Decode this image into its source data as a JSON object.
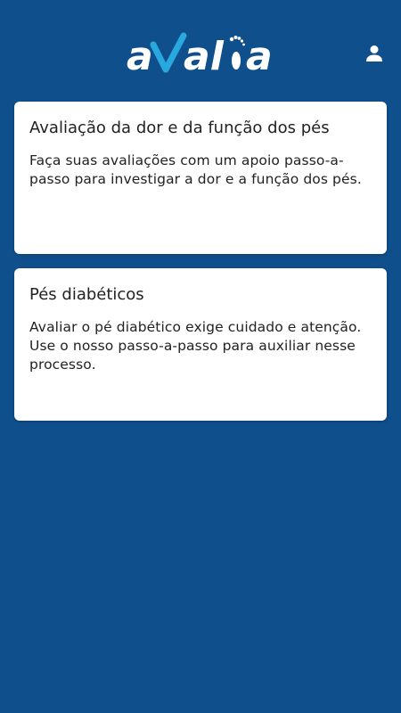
{
  "app": {
    "name": "avalia",
    "colors": {
      "background": "#0f4f8c",
      "card": "#ffffff",
      "text": "#222222",
      "logo": "#ffffff",
      "logo_check": "#29a8df"
    }
  },
  "header": {
    "logo_text": "avalia",
    "profile_icon": "person-icon"
  },
  "cards": [
    {
      "title": "Avaliação da dor e da função dos pés",
      "description": "Faça suas avaliações com um apoio passo-a-passo para investigar a dor e a função dos pés."
    },
    {
      "title": "Pés diabéticos",
      "description": "Avaliar o pé diabético exige cuidado e atenção. Use o nosso passo-a-passo para auxiliar nesse processo."
    }
  ]
}
